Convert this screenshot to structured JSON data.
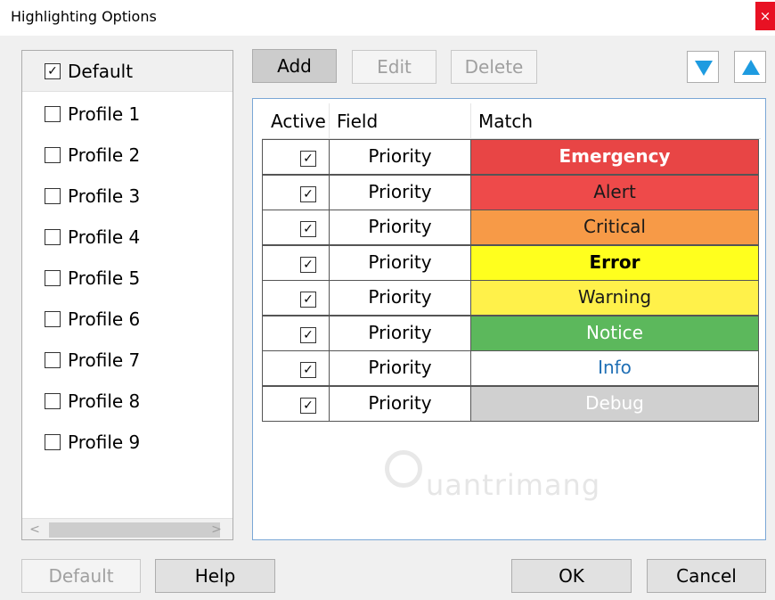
{
  "window": {
    "title": "Highlighting Options",
    "close_label": "×"
  },
  "profiles": {
    "items": [
      {
        "label": "Default",
        "checked": "✓"
      },
      {
        "label": "Profile 1",
        "checked": ""
      },
      {
        "label": "Profile 2",
        "checked": ""
      },
      {
        "label": "Profile 3",
        "checked": ""
      },
      {
        "label": "Profile 4",
        "checked": ""
      },
      {
        "label": "Profile 5",
        "checked": ""
      },
      {
        "label": "Profile 6",
        "checked": ""
      },
      {
        "label": "Profile 7",
        "checked": ""
      },
      {
        "label": "Profile 8",
        "checked": ""
      },
      {
        "label": "Profile 9",
        "checked": ""
      }
    ],
    "scroll_left": "<",
    "scroll_right": ">"
  },
  "toolbar": {
    "add": "Add",
    "edit": "Edit",
    "delete": "Delete"
  },
  "table": {
    "columns": [
      "Active",
      "Field",
      "Match"
    ],
    "rows": [
      {
        "active": "✓",
        "field": "Priority",
        "match": "Emergency",
        "bg": "#e84545",
        "fg": "#ffffff",
        "bold": true
      },
      {
        "active": "✓",
        "field": "Priority",
        "match": "Alert",
        "bg": "#ee4a4a",
        "fg": "#1a1a1a",
        "bold": false
      },
      {
        "active": "✓",
        "field": "Priority",
        "match": "Critical",
        "bg": "#f79a47",
        "fg": "#1a1a1a",
        "bold": false
      },
      {
        "active": "✓",
        "field": "Priority",
        "match": "Error",
        "bg": "#ffff1e",
        "fg": "#000000",
        "bold": true
      },
      {
        "active": "✓",
        "field": "Priority",
        "match": "Warning",
        "bg": "#fff14a",
        "fg": "#1a1a1a",
        "bold": false
      },
      {
        "active": "✓",
        "field": "Priority",
        "match": "Notice",
        "bg": "#5cb85c",
        "fg": "#ffffff",
        "bold": false
      },
      {
        "active": "✓",
        "field": "Priority",
        "match": "Info",
        "bg": "#ffffff",
        "fg": "#1f6fb5",
        "bold": false
      },
      {
        "active": "✓",
        "field": "Priority",
        "match": "Debug",
        "bg": "#d0d0d0",
        "fg": "#ffffff",
        "bold": false
      }
    ]
  },
  "watermark": {
    "text": "uantrimang"
  },
  "footer": {
    "default": "Default",
    "help": "Help",
    "ok": "OK",
    "cancel": "Cancel"
  },
  "colors": {
    "arrow_accent": "#1e9be0",
    "rules_border": "#7aa7d6"
  }
}
